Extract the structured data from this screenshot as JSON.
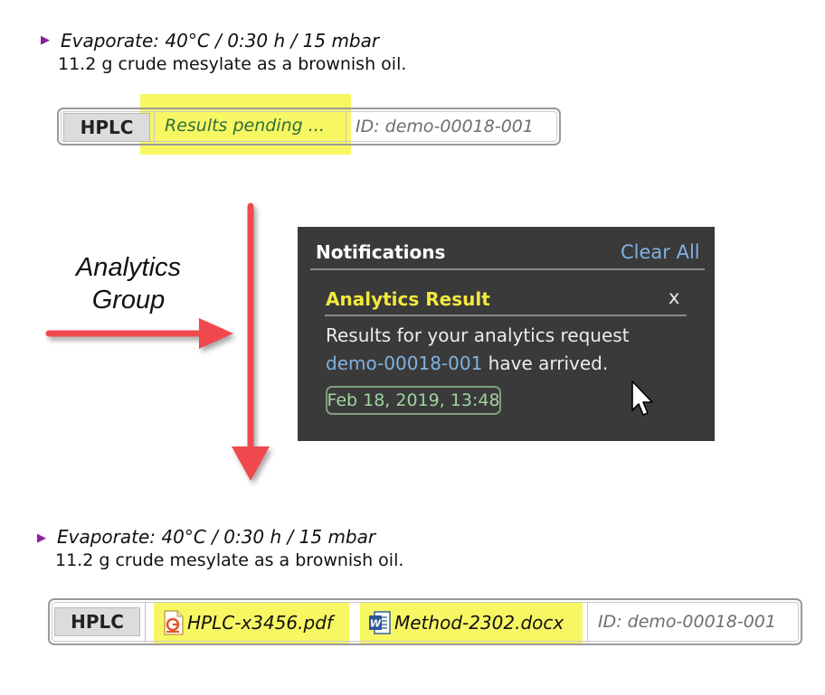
{
  "top_step": {
    "title": "Evaporate: 40°C / 0:30 h / 15 mbar",
    "description": "11.2 g crude mesylate as a brownish oil."
  },
  "top_analytics": {
    "method_label": "HPLC",
    "status": "Results pending ...",
    "id": "ID: demo-00018-001"
  },
  "group": {
    "line1": "Analytics",
    "line2": "Group"
  },
  "notifications": {
    "title": "Notifications",
    "clear_all": "Clear All",
    "card": {
      "title": "Analytics Result",
      "close": "x",
      "message_line1": "Results for your analytics request",
      "message_link": "demo-00018-001",
      "message_rest": " have arrived.",
      "timestamp": "Feb 18, 2019, 13:48"
    }
  },
  "bottom_step": {
    "title": "Evaporate: 40°C / 0:30 h / 15 mbar",
    "description": "11.2 g crude mesylate as a brownish oil."
  },
  "bottom_analytics": {
    "method_label": "HPLC",
    "files": [
      {
        "name": "HPLC-x3456.pdf",
        "icon": "pdf-file-icon"
      },
      {
        "name": "Method-2302.docx",
        "icon": "word-file-icon"
      }
    ],
    "id": "ID: demo-00018-001"
  },
  "colors": {
    "highlight": "#f5f542",
    "arrow": "#f0484e",
    "panel_bg": "#3a3a3a",
    "link": "#7fb2e0",
    "card_title": "#f2e93c",
    "timestamp": "#9fd49f",
    "step_marker": "#8a1f9c"
  },
  "icons": {
    "step_marker": "triangle-right-icon",
    "cursor": "mouse-pointer-icon"
  }
}
